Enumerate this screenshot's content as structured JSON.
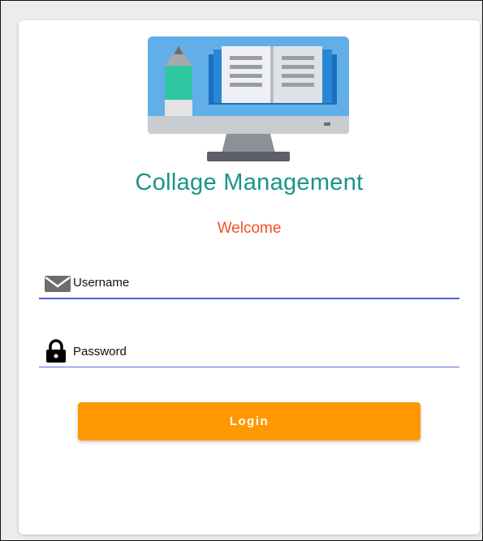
{
  "app": {
    "title": "Collage Management",
    "welcome": "Welcome"
  },
  "form": {
    "username": {
      "placeholder": "Username",
      "value": "",
      "icon": "envelope-icon"
    },
    "password": {
      "placeholder": "Password",
      "value": "",
      "icon": "lock-icon"
    },
    "login_label": "Login"
  },
  "colors": {
    "title": "#17958a",
    "welcome": "#f4511e",
    "accent_underline": "#4c5fd7",
    "button": "#ff9800"
  },
  "logo": {
    "icon": "computer-book-logo-icon"
  }
}
